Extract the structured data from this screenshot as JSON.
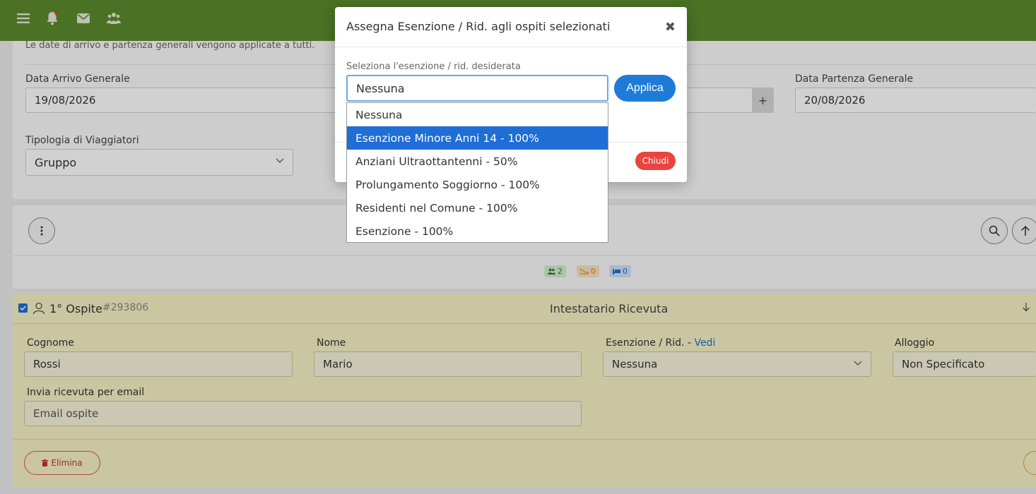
{
  "topbar": {
    "bg": "#5b8a2d",
    "icons": [
      "menu-icon",
      "bell-icon",
      "mail-icon",
      "users-icon"
    ]
  },
  "general": {
    "info_text": "Le date di arrivo e partenza generali vengono applicate a tutti.",
    "arrival_label": "Data Arrivo Generale",
    "arrival_value": "19/08/2026",
    "departure_label": "Data Partenza Generale",
    "departure_value": "20/08/2026",
    "plus_label": "+",
    "traveler_type_label": "Tipologia di Viaggiatori",
    "traveler_type_value": "Gruppo"
  },
  "summary": {
    "guests_count": "2",
    "exits_count": "0",
    "beds_count": "0"
  },
  "guest": {
    "title": "1° Ospite",
    "id": "#293806",
    "header_center": "Intestatario Ricevuta",
    "cognome_label": "Cognome",
    "cognome_value": "Rossi",
    "nome_label": "Nome",
    "nome_value": "Mario",
    "esenzione_label": "Esenzione / Rid. -",
    "esenzione_link": "Vedi",
    "esenzione_value": "Nessuna",
    "alloggio_label": "Alloggio",
    "alloggio_value": "Non Specificato",
    "email_label": "Invia ricevuta per email",
    "email_placeholder": "Email ospite",
    "delete_label": "Elimina"
  },
  "modal": {
    "title": "Assegna Esenzione / Rid. agli ospiti selezionati",
    "close": "✖",
    "select_label": "Seleziona l'esenzione / rid. desiderata",
    "select_value": "Nessuna",
    "apply_label": "Applica",
    "chiudi_label": "Chiudi",
    "options": [
      "Nessuna",
      "Esenzione Minore Anni 14 - 100%",
      "Anziani Ultraottantenni - 50%",
      "Prolungamento Soggiorno - 100%",
      "Residenti nel Comune - 100%",
      "Esenzione - 100%"
    ],
    "highlighted_option_index": 1,
    "accent": "#1e7bd8"
  }
}
